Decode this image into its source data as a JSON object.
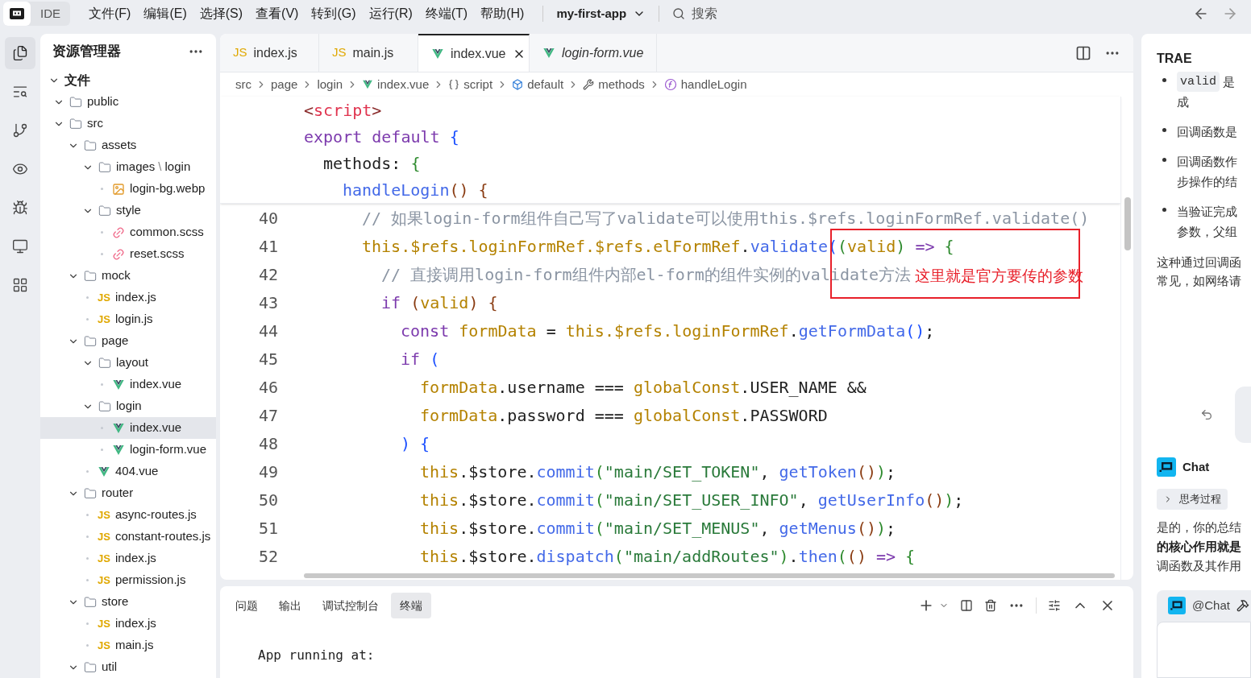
{
  "topbar": {
    "modes": [
      {
        "kind": "logo",
        "selected": true
      },
      {
        "kind": "text",
        "label": "IDE",
        "selected": false
      }
    ],
    "menus": [
      "文件(F)",
      "编辑(E)",
      "选择(S)",
      "查看(V)",
      "转到(G)",
      "运行(R)",
      "终端(T)",
      "帮助(H)"
    ],
    "project": "my-first-app",
    "search": {
      "placeholder": "搜索"
    }
  },
  "activity": [
    {
      "kind": "files",
      "selected": true
    },
    {
      "kind": "search",
      "selected": false
    },
    {
      "kind": "git",
      "selected": false
    },
    {
      "kind": "remote",
      "selected": false
    },
    {
      "kind": "debug",
      "selected": false
    },
    {
      "kind": "monitor",
      "selected": false
    },
    {
      "kind": "extensions",
      "selected": false
    }
  ],
  "explorer": {
    "title": "资源管理器",
    "tree": [
      {
        "kind": "root",
        "label": "文件",
        "expanded": true,
        "selected": false,
        "children": [
          {
            "kind": "folder",
            "label": "public",
            "expanded": true,
            "selected": false
          },
          {
            "kind": "folder",
            "label": "src",
            "expanded": true,
            "selected": false,
            "children": [
              {
                "kind": "folder",
                "label": "assets",
                "expanded": true,
                "selected": false,
                "children": [
                  {
                    "kind": "folder",
                    "label": "images",
                    "separator": "\\",
                    "sublabel": "login",
                    "expanded": true,
                    "selected": false,
                    "children": [
                      {
                        "kind": "image",
                        "label": "login-bg.webp",
                        "selected": false
                      }
                    ]
                  },
                  {
                    "kind": "folder",
                    "label": "style",
                    "expanded": true,
                    "selected": false,
                    "children": [
                      {
                        "kind": "scss",
                        "label": "common.scss",
                        "selected": false
                      },
                      {
                        "kind": "scss",
                        "label": "reset.scss",
                        "selected": false
                      }
                    ]
                  }
                ]
              },
              {
                "kind": "folder",
                "label": "mock",
                "expanded": true,
                "selected": false,
                "children": [
                  {
                    "kind": "js",
                    "icon_text": "JS",
                    "label": "index.js",
                    "selected": false
                  },
                  {
                    "kind": "js",
                    "icon_text": "JS",
                    "label": "login.js",
                    "selected": false
                  }
                ]
              },
              {
                "kind": "folder",
                "label": "page",
                "expanded": true,
                "selected": false,
                "children": [
                  {
                    "kind": "folder",
                    "label": "layout",
                    "expanded": true,
                    "selected": false,
                    "children": [
                      {
                        "kind": "vue",
                        "label": "index.vue",
                        "selected": false
                      }
                    ]
                  },
                  {
                    "kind": "folder",
                    "label": "login",
                    "expanded": true,
                    "selected": false,
                    "children": [
                      {
                        "kind": "vue",
                        "label": "index.vue",
                        "selected": true
                      },
                      {
                        "kind": "vue",
                        "label": "login-form.vue",
                        "selected": false
                      }
                    ]
                  },
                  {
                    "kind": "vue",
                    "label": "404.vue",
                    "selected": false
                  }
                ]
              },
              {
                "kind": "folder",
                "label": "router",
                "expanded": true,
                "selected": false,
                "children": [
                  {
                    "kind": "js",
                    "icon_text": "JS",
                    "label": "async-routes.js",
                    "selected": false
                  },
                  {
                    "kind": "js",
                    "icon_text": "JS",
                    "label": "constant-routes.js",
                    "selected": false
                  },
                  {
                    "kind": "js",
                    "icon_text": "JS",
                    "label": "index.js",
                    "selected": false
                  },
                  {
                    "kind": "js",
                    "icon_text": "JS",
                    "label": "permission.js",
                    "selected": false
                  }
                ]
              },
              {
                "kind": "folder",
                "label": "store",
                "expanded": true,
                "selected": false,
                "children": [
                  {
                    "kind": "js",
                    "icon_text": "JS",
                    "label": "index.js",
                    "selected": false
                  },
                  {
                    "kind": "js",
                    "icon_text": "JS",
                    "label": "main.js",
                    "selected": false
                  }
                ]
              },
              {
                "kind": "folder",
                "label": "util",
                "expanded": true,
                "selected": false
              }
            ]
          }
        ]
      }
    ]
  },
  "tabs": [
    {
      "kind": "js",
      "icon_text": "JS",
      "label": "index.js",
      "selected": false,
      "preview": false
    },
    {
      "kind": "js",
      "icon_text": "JS",
      "label": "main.js",
      "selected": false,
      "preview": false
    },
    {
      "kind": "vue",
      "label": "index.vue",
      "selected": true,
      "preview": false
    },
    {
      "kind": "vue",
      "label": "login-form.vue",
      "selected": false,
      "preview": true
    }
  ],
  "breadcrumb": [
    {
      "kind": "none",
      "label": "src"
    },
    {
      "kind": "none",
      "label": "page"
    },
    {
      "kind": "none",
      "label": "login"
    },
    {
      "kind": "vue",
      "label": "index.vue"
    },
    {
      "kind": "braces",
      "label": "script"
    },
    {
      "kind": "module",
      "label": "default"
    },
    {
      "kind": "wrench",
      "label": "methods"
    },
    {
      "kind": "function",
      "label": "handleLogin"
    }
  ],
  "sticky_lines": [
    {
      "tokens": [
        {
          "kind": "tagp",
          "text": "<"
        },
        {
          "kind": "tag",
          "text": "script"
        },
        {
          "kind": "tagp",
          "text": ">"
        }
      ]
    },
    {
      "tokens": [
        {
          "kind": "kw",
          "text": "export default "
        },
        {
          "kind": "b1",
          "text": "{"
        }
      ],
      "children": [
        {
          "tokens": [
            {
              "kind": "plain",
              "text": "methods: "
            },
            {
              "kind": "b2",
              "text": "{"
            }
          ],
          "children": [
            {
              "tokens": [
                {
                  "kind": "fn",
                  "text": "handleLogin"
                },
                {
                  "kind": "b3",
                  "text": "() {"
                }
              ]
            }
          ]
        }
      ]
    }
  ],
  "code_lines": [
    {
      "number": "40",
      "tokens": [
        {
          "kind": "comment",
          "text": "// 如果login-form组件自己写了validate可以使用this.$refs.loginFormRef.validate()"
        }
      ]
    },
    {
      "number": "41",
      "tokens": [
        {
          "kind": "var",
          "text": "this.$refs.loginFormRef.$refs.elFormRef"
        },
        {
          "kind": "plain",
          "text": "."
        },
        {
          "kind": "fn",
          "text": "validate"
        },
        {
          "kind": "b1",
          "text": "("
        },
        {
          "kind": "b2",
          "text": "("
        },
        {
          "kind": "var",
          "text": "valid"
        },
        {
          "kind": "b2",
          "text": ")"
        },
        {
          "kind": "kw",
          "text": " => "
        },
        {
          "kind": "b2",
          "text": "{"
        }
      ],
      "children": [
        {
          "number": "42",
          "tokens": [
            {
              "kind": "comment",
              "text": "// 直接调用login-form组件内部el-form的组件实例的validate方法"
            }
          ]
        },
        {
          "number": "43",
          "tokens": [
            {
              "kind": "kw",
              "text": "if"
            },
            {
              "kind": "b3",
              "text": " ("
            },
            {
              "kind": "var",
              "text": "valid"
            },
            {
              "kind": "b3",
              "text": ") {"
            }
          ],
          "children": [
            {
              "number": "44",
              "tokens": [
                {
                  "kind": "kw",
                  "text": "const"
                },
                {
                  "kind": "var",
                  "text": " formData"
                },
                {
                  "kind": "plain",
                  "text": " = "
                },
                {
                  "kind": "var",
                  "text": "this.$refs.loginFormRef"
                },
                {
                  "kind": "plain",
                  "text": "."
                },
                {
                  "kind": "fn",
                  "text": "getFormData"
                },
                {
                  "kind": "b1",
                  "text": "()"
                },
                {
                  "kind": "plain",
                  "text": ";"
                }
              ]
            },
            {
              "number": "45",
              "tokens": [
                {
                  "kind": "kw",
                  "text": "if"
                },
                {
                  "kind": "b1",
                  "text": " ("
                }
              ],
              "children": [
                {
                  "number": "46",
                  "tokens": [
                    {
                      "kind": "var",
                      "text": "formData"
                    },
                    {
                      "kind": "plain",
                      "text": ".username === "
                    },
                    {
                      "kind": "var",
                      "text": "globalConst"
                    },
                    {
                      "kind": "plain",
                      "text": ".USER_NAME &&"
                    }
                  ]
                },
                {
                  "number": "47",
                  "tokens": [
                    {
                      "kind": "var",
                      "text": "formData"
                    },
                    {
                      "kind": "plain",
                      "text": ".password === "
                    },
                    {
                      "kind": "var",
                      "text": "globalConst"
                    },
                    {
                      "kind": "plain",
                      "text": ".PASSWORD"
                    }
                  ]
                }
              ]
            },
            {
              "number": "48",
              "tokens": [
                {
                  "kind": "b1",
                  "text": ") {"
                }
              ],
              "children": [
                {
                  "number": "49",
                  "tokens": [
                    {
                      "kind": "var",
                      "text": "this"
                    },
                    {
                      "kind": "plain",
                      "text": ".$store."
                    },
                    {
                      "kind": "fn",
                      "text": "commit"
                    },
                    {
                      "kind": "b2",
                      "text": "("
                    },
                    {
                      "kind": "str",
                      "text": "\"main/SET_TOKEN\""
                    },
                    {
                      "kind": "plain",
                      "text": ", "
                    },
                    {
                      "kind": "fn",
                      "text": "getToken"
                    },
                    {
                      "kind": "b3",
                      "text": "()"
                    },
                    {
                      "kind": "b2",
                      "text": ")"
                    },
                    {
                      "kind": "plain",
                      "text": ";"
                    }
                  ]
                },
                {
                  "number": "50",
                  "tokens": [
                    {
                      "kind": "var",
                      "text": "this"
                    },
                    {
                      "kind": "plain",
                      "text": ".$store."
                    },
                    {
                      "kind": "fn",
                      "text": "commit"
                    },
                    {
                      "kind": "b2",
                      "text": "("
                    },
                    {
                      "kind": "str",
                      "text": "\"main/SET_USER_INFO\""
                    },
                    {
                      "kind": "plain",
                      "text": ", "
                    },
                    {
                      "kind": "fn",
                      "text": "getUserInfo"
                    },
                    {
                      "kind": "b3",
                      "text": "()"
                    },
                    {
                      "kind": "b2",
                      "text": ")"
                    },
                    {
                      "kind": "plain",
                      "text": ";"
                    }
                  ]
                },
                {
                  "number": "51",
                  "tokens": [
                    {
                      "kind": "var",
                      "text": "this"
                    },
                    {
                      "kind": "plain",
                      "text": ".$store."
                    },
                    {
                      "kind": "fn",
                      "text": "commit"
                    },
                    {
                      "kind": "b2",
                      "text": "("
                    },
                    {
                      "kind": "str",
                      "text": "\"main/SET_MENUS\""
                    },
                    {
                      "kind": "plain",
                      "text": ", "
                    },
                    {
                      "kind": "fn",
                      "text": "getMenus"
                    },
                    {
                      "kind": "b3",
                      "text": "()"
                    },
                    {
                      "kind": "b2",
                      "text": ")"
                    },
                    {
                      "kind": "plain",
                      "text": ";"
                    }
                  ]
                },
                {
                  "number": "52",
                  "tokens": [
                    {
                      "kind": "var",
                      "text": "this"
                    },
                    {
                      "kind": "plain",
                      "text": ".$store."
                    },
                    {
                      "kind": "fn",
                      "text": "dispatch"
                    },
                    {
                      "kind": "b2",
                      "text": "("
                    },
                    {
                      "kind": "str",
                      "text": "\"main/addRoutes\""
                    },
                    {
                      "kind": "b2",
                      "text": ")"
                    },
                    {
                      "kind": "plain",
                      "text": "."
                    },
                    {
                      "kind": "fn",
                      "text": "then"
                    },
                    {
                      "kind": "b2",
                      "text": "("
                    },
                    {
                      "kind": "b3",
                      "text": "()"
                    },
                    {
                      "kind": "kw",
                      "text": " => "
                    },
                    {
                      "kind": "b2",
                      "text": "{"
                    }
                  ]
                }
              ]
            }
          ]
        }
      ]
    }
  ],
  "annotation": {
    "text": "这里就是官方要传的参数",
    "color": "#e8202a"
  },
  "panel": {
    "tabs": [
      {
        "label": "问题",
        "selected": false
      },
      {
        "label": "输出",
        "selected": false
      },
      {
        "label": "调试控制台",
        "selected": false
      },
      {
        "label": "终端",
        "selected": true
      }
    ],
    "terminal": [
      "App running at:"
    ]
  },
  "assistant": {
    "title": "TRAE",
    "bullets": [
      {
        "code": "valid",
        "lines": [
          "是",
          "成"
        ]
      },
      {
        "lines": [
          "回调函数是"
        ]
      },
      {
        "lines": [
          "回调函数作",
          "步操作的结"
        ]
      },
      {
        "lines": [
          "当验证完成",
          "参数，父组"
        ]
      }
    ],
    "paragraph": [
      "这种通过回调函",
      "常见，如网络请"
    ],
    "agent": "Chat",
    "thinking": "思考过程",
    "answer": [
      {
        "text": "是的，你的总结",
        "bold": false
      },
      {
        "text": "的核心作用就是",
        "bold": true
      },
      {
        "text": "调函数及其作用",
        "bold": false
      }
    ],
    "input_agent": "@Chat"
  }
}
